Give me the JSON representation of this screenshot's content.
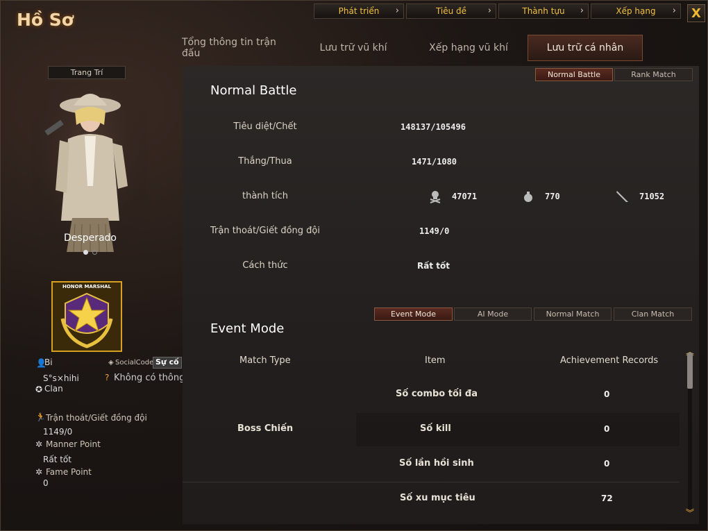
{
  "window": {
    "title": "Hồ Sơ",
    "close_glyph": "X"
  },
  "topnav": [
    {
      "label": "Phát triển"
    },
    {
      "label": "Tiêu đề"
    },
    {
      "label": "Thành tựu"
    },
    {
      "label": "Xếp hạng"
    }
  ],
  "tabs": [
    "Tổng thông tin trận đấu",
    "Lưu trữ vũ khí",
    "Xếp hạng vũ khí",
    "Lưu trữ cá nhân"
  ],
  "sidebar": {
    "decorate_button": "Trang Trí",
    "character_name": "Desperado",
    "rank_badge_text": "HONOR MARSHAL",
    "user_label": "Bi",
    "social_code_label": "SocialCode",
    "social_code_value": "Sự cố",
    "nickname": "S°s×hihi",
    "clan_label": "Clan",
    "clan_value": "Không có thông tin",
    "escape_label": "Trận thoát/Giết đồng đội",
    "escape_value": "1149/0",
    "manner_label": "Manner Point",
    "manner_value": "Rất tốt",
    "fame_label": "Fame Point",
    "fame_value": "0"
  },
  "mode_toggle": {
    "normal": "Normal Battle",
    "rank": "Rank Match"
  },
  "normal_battle": {
    "title": "Normal Battle",
    "kd_label": "Tiêu diệt/Chết",
    "kd_value": "148137/105496",
    "wl_label": "Thắng/Thua",
    "wl_value": "1471/1080",
    "ach_label": "thành tích",
    "ach_values": [
      "47071",
      "770",
      "71052"
    ],
    "escape_label": "Trận thoát/Giết đồng đội",
    "escape_value": "1149/0",
    "manner_label": "Cách thức",
    "manner_value": "Rất tốt"
  },
  "event_tabs": [
    "Event Mode",
    "AI Mode",
    "Normal Match",
    "Clan Match"
  ],
  "event": {
    "title": "Event Mode",
    "headers": [
      "Match Type",
      "Item",
      "Achievement Records"
    ],
    "match_type": "Boss Chiến",
    "rows": [
      {
        "item": "Số combo tối đa",
        "value": "0"
      },
      {
        "item": "Số kill",
        "value": "0"
      },
      {
        "item": "Số lần hồi sinh",
        "value": "0"
      },
      {
        "item": "Số xu mục tiêu",
        "value": "72"
      }
    ]
  }
}
